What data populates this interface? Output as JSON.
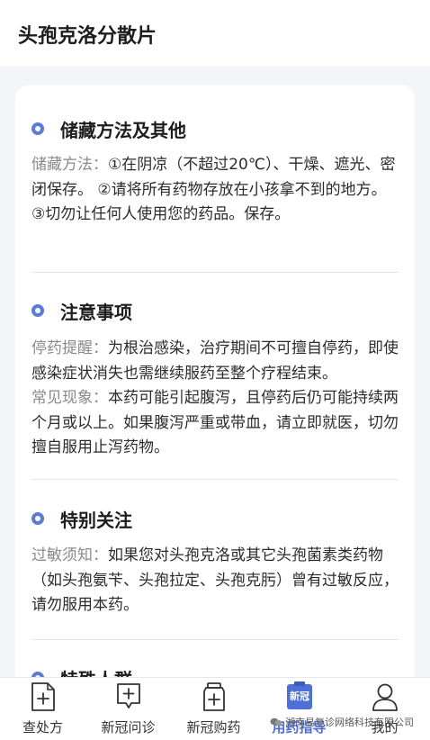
{
  "header": {
    "title": "头孢克洛分散片"
  },
  "sections": [
    {
      "title": "储藏方法及其他",
      "paragraphs": [
        {
          "label": "储藏方法：",
          "text": "①在阴凉（不超过20℃）、干燥、遮光、密闭保存。 ②请将所有药物存放在小孩拿不到的地方。 ③切勿让任何人使用您的药品。保存。"
        }
      ]
    },
    {
      "title": "注意事项",
      "paragraphs": [
        {
          "label": "停药提醒：",
          "text": "为根治感染，治疗期间不可擅自停药，即使感染症状消失也需继续服药至整个疗程结束。"
        },
        {
          "label": "常见现象：",
          "text": "本药可能引起腹泻，且停药后仍可能持续两个月或以上。如果腹泻严重或带血，请立即就医，切勿擅自服用止泻药物。"
        }
      ]
    },
    {
      "title": "特别关注",
      "paragraphs": [
        {
          "label": "过敏须知：",
          "text": "如果您对头孢克洛或其它头孢菌素类药物（如头孢氨苄、头孢拉定、头孢克肟）曾有过敏反应，请勿服用本药。"
        }
      ]
    },
    {
      "title": "特殊人群",
      "paragraphs": []
    }
  ],
  "tabbar": {
    "tabs": [
      {
        "label": "查处方",
        "icon": "prescription-icon"
      },
      {
        "label": "新冠问诊",
        "icon": "consult-icon"
      },
      {
        "label": "新冠购药",
        "icon": "medicine-bottle-icon"
      },
      {
        "label": "用药指导",
        "icon": "xinguan-badge-icon",
        "badge": "新冠",
        "active": true
      },
      {
        "label": "我的",
        "icon": "person-icon"
      }
    ]
  },
  "watermark": {
    "text": "湖南易复诊网络科技有限公司"
  },
  "colors": {
    "accent": "#4d6fd8",
    "dot": "#5b7ae0",
    "background": "#f4f5f8"
  }
}
